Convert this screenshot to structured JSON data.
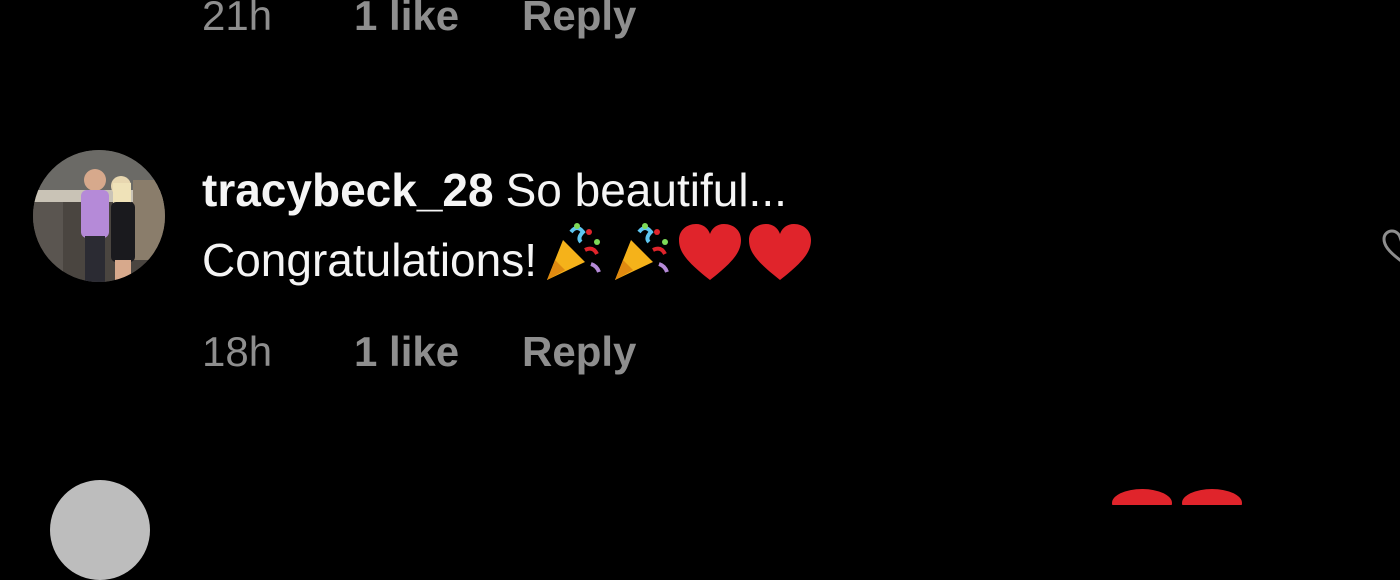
{
  "previous_comment": {
    "time": "21h",
    "likes": "1 like",
    "reply_label": "Reply"
  },
  "comment": {
    "username": "tracybeck_28",
    "text_line1": "So beautiful...",
    "text_line2": "Congratulations!",
    "emojis": [
      "party-popper",
      "party-popper",
      "red-heart",
      "red-heart"
    ],
    "time": "18h",
    "likes": "1 like",
    "reply_label": "Reply"
  },
  "colors": {
    "background": "#000000",
    "text": "#f5f5f5",
    "meta": "#8e8e8e",
    "heart": "#e0242b"
  }
}
